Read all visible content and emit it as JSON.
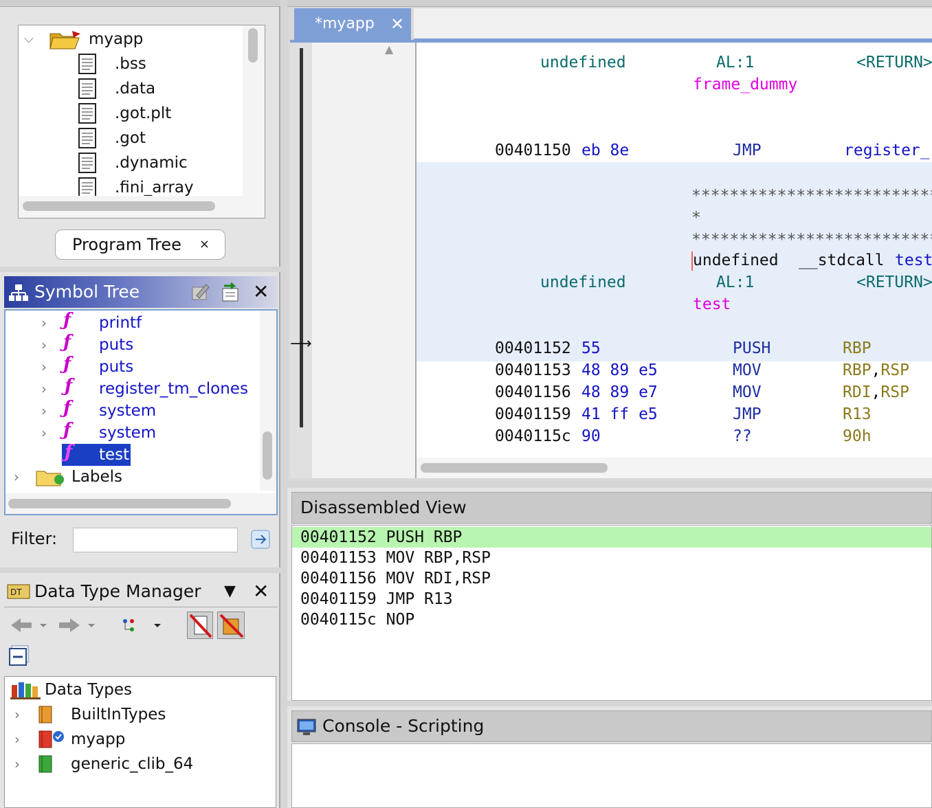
{
  "program_tree": {
    "root": "myapp",
    "items": [
      ".bss",
      ".data",
      ".got.plt",
      ".got",
      ".dynamic",
      ".fini_array"
    ],
    "tab_label": "Program Tree",
    "tab_close": "×"
  },
  "symbol_tree": {
    "title": "Symbol Tree",
    "close": "✕",
    "items": [
      "printf",
      "puts",
      "puts",
      "register_tm_clones",
      "system",
      "system",
      "test"
    ],
    "selected": "test",
    "labels_folder": "Labels",
    "filter_label": "Filter:",
    "filter_value": ""
  },
  "data_type_manager": {
    "title": "Data Type Manager",
    "close": "✕",
    "root": "Data Types",
    "items": [
      "BuiltInTypes",
      "myapp",
      "generic_clib_64"
    ]
  },
  "listing": {
    "tab_label": "*myapp",
    "tab_close": "✕",
    "lines": {
      "l1_type": "undefined",
      "l1_reg": "AL:1",
      "l1_ret": "<RETURN>",
      "l2_label": "frame_dummy",
      "l3_addr": "00401150",
      "l3_bytes": "eb 8e",
      "l3_mnem": "JMP",
      "l3_op": "register_",
      "stars1": "***************************",
      "star_single": "*",
      "stars2": "***************************",
      "sig_ret": "undefined",
      "sig_conv": "__stdcall",
      "sig_name": "test(",
      "l6_type": "undefined",
      "l6_reg": "AL:1",
      "l6_ret": "<RETURN>",
      "l7_label": "test",
      "r1_addr": "00401152",
      "r1_bytes": "55",
      "r1_mnem": "PUSH",
      "r1_op": "RBP",
      "r2_addr": "00401153",
      "r2_bytes": "48 89 e5",
      "r2_mnem": "MOV",
      "r2_op1": "RBP",
      "r2_comma": ",",
      "r2_op2": "RSP",
      "r3_addr": "00401156",
      "r3_bytes": "48 89 e7",
      "r3_mnem": "MOV",
      "r3_op1": "RDI",
      "r3_comma": ",",
      "r3_op2": "RSP",
      "r4_addr": "00401159",
      "r4_bytes": "41 ff e5",
      "r4_mnem": "JMP",
      "r4_op": "R13",
      "r5_addr": "0040115c",
      "r5_bytes": "90",
      "r5_mnem": "??",
      "r5_op": "90h"
    }
  },
  "disassembled_view": {
    "title": "Disassembled View",
    "rows": [
      "00401152 PUSH RBP",
      "00401153 MOV RBP,RSP",
      "00401156 MOV RDI,RSP",
      "00401159 JMP R13",
      "0040115c NOP"
    ],
    "highlight_color": "#b8f5b0"
  },
  "console": {
    "title": "Console - Scripting"
  },
  "colors": {
    "selection": "#1a3fc4",
    "highlight_bg": "#e6eefa",
    "tab_active": "#7e9ed6"
  }
}
